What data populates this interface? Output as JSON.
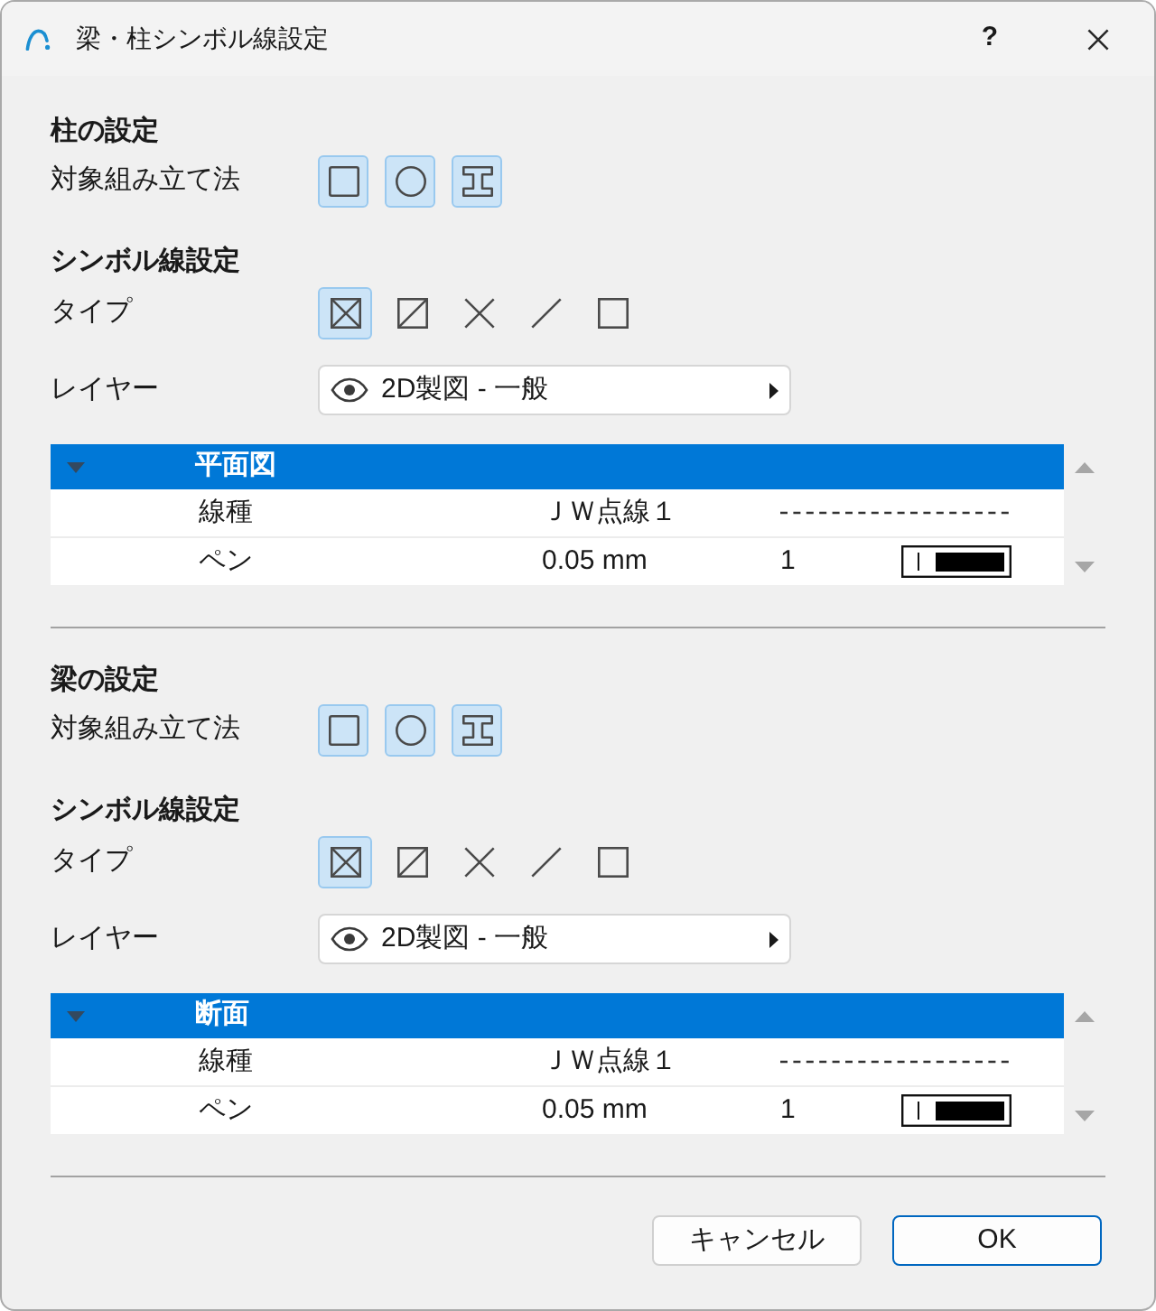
{
  "window": {
    "title": "梁・柱シンボル線設定",
    "help": "?"
  },
  "sections": [
    {
      "heading": "柱の設定",
      "method": {
        "label": "対象組み立て法",
        "options": [
          {
            "kind": "rectangle",
            "selected": true
          },
          {
            "kind": "circle",
            "selected": true
          },
          {
            "kind": "i-beam",
            "selected": true
          }
        ]
      },
      "symbol_heading": "シンボル線設定",
      "type": {
        "label": "タイプ",
        "options": [
          {
            "kind": "cross-box",
            "selected": true
          },
          {
            "kind": "slash-box",
            "selected": false
          },
          {
            "kind": "cross",
            "selected": false
          },
          {
            "kind": "slash",
            "selected": false
          },
          {
            "kind": "box",
            "selected": false
          }
        ]
      },
      "layer": {
        "label": "レイヤー",
        "value": "2D製図 - 一般"
      },
      "table": {
        "group": {
          "label": "平面図",
          "expanded": true,
          "selected": true
        },
        "rows": [
          {
            "kind": "line-type",
            "label": "線種",
            "value": "ＪＷ点線１"
          },
          {
            "kind": "pen",
            "label": "ペン",
            "value": "0.05 mm",
            "pen_number": "1"
          }
        ]
      }
    },
    {
      "heading": "梁の設定",
      "method": {
        "label": "対象組み立て法",
        "options": [
          {
            "kind": "rectangle",
            "selected": true
          },
          {
            "kind": "circle",
            "selected": true
          },
          {
            "kind": "i-beam",
            "selected": true
          }
        ]
      },
      "symbol_heading": "シンボル線設定",
      "type": {
        "label": "タイプ",
        "options": [
          {
            "kind": "cross-box",
            "selected": true
          },
          {
            "kind": "slash-box",
            "selected": false
          },
          {
            "kind": "cross",
            "selected": false
          },
          {
            "kind": "slash",
            "selected": false
          },
          {
            "kind": "box",
            "selected": false
          }
        ]
      },
      "layer": {
        "label": "レイヤー",
        "value": "2D製図 - 一般"
      },
      "table": {
        "group": {
          "label": "断面",
          "expanded": true,
          "selected": true
        },
        "rows": [
          {
            "kind": "line-type",
            "label": "線種",
            "value": "ＪＷ点線１"
          },
          {
            "kind": "pen",
            "label": "ペン",
            "value": "0.05 mm",
            "pen_number": "1"
          }
        ]
      }
    }
  ],
  "buttons": [
    {
      "label": "キャンセル",
      "default": false
    },
    {
      "label": "OK",
      "default": true
    }
  ]
}
